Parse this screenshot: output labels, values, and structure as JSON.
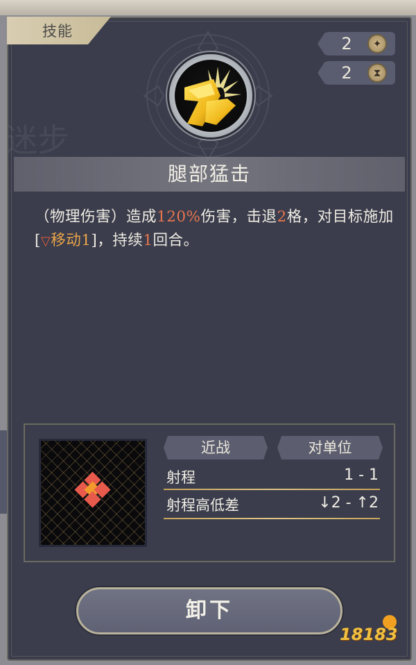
{
  "tab": {
    "label": "技能"
  },
  "counters": [
    {
      "value": "2",
      "icon": "star-icon"
    },
    {
      "value": "2",
      "icon": "hourglass-icon"
    }
  ],
  "skill": {
    "icon": "kick-strike-skill-icon",
    "name": "腿部猛击",
    "description": {
      "p1": "（物理伤害）造成",
      "damage": "120%",
      "p2": "伤害，击退",
      "knockback": "2",
      "p3": "格，对目标施加[",
      "debuff_icon": "down-triangle-icon",
      "debuff": "移动1",
      "p4": "]，持续",
      "duration": "1",
      "p5": "回合。"
    }
  },
  "range_info": {
    "tags": [
      "近战",
      "对单位"
    ],
    "rows": [
      {
        "label": "射程",
        "value": "1 - 1"
      },
      {
        "label": "射程高低差",
        "value": "↓2 - ↑2"
      }
    ]
  },
  "unload_button": {
    "label": "卸下"
  },
  "watermark": {
    "text": "18183"
  },
  "colors": {
    "highlight": "#e8764f",
    "debuff": "#e9a44a",
    "panel": "#3b3d4c",
    "gold": "#c7a45a"
  }
}
